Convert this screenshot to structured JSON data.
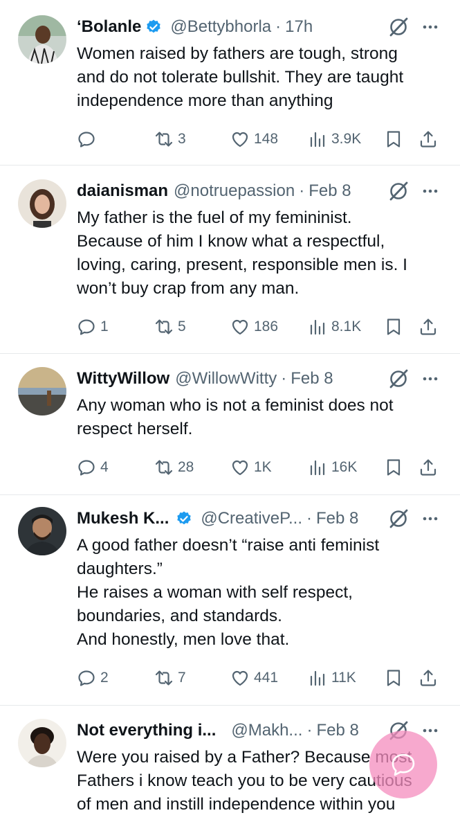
{
  "tweets": [
    {
      "name": "‘Bolanle",
      "verified": true,
      "handle": "@Bettybhorla",
      "time": "17h",
      "lines": [
        "Women raised by fathers are tough, strong",
        "and do not tolerate bullshit. They are taught",
        "independence more than anything"
      ],
      "replies": "",
      "reposts": "3",
      "likes": "148",
      "views": "3.9K"
    },
    {
      "name": "daianisman",
      "verified": false,
      "handle": "@notruepassion",
      "time": "Feb 8",
      "lines": [
        "My father is the fuel of my femininist.",
        "Because of him I know what a respectful,",
        "loving, caring, present, responsible men is. I",
        "won’t buy crap from any man."
      ],
      "replies": "1",
      "reposts": "5",
      "likes": "186",
      "views": "8.1K"
    },
    {
      "name": "WittyWillow",
      "verified": false,
      "handle": "@WillowWitty",
      "time": "Feb 8",
      "lines": [
        "Any woman who is not a feminist does not",
        "respect herself."
      ],
      "replies": "4",
      "reposts": "28",
      "likes": "1K",
      "views": "16K"
    },
    {
      "name": "Mukesh K...",
      "verified": true,
      "handle": "@CreativeP...",
      "time": "Feb 8",
      "lines": [
        "A good father doesn’t “raise anti feminist",
        "daughters.”",
        "He raises a woman with self respect,",
        "boundaries, and standards.",
        "And honestly, men love that."
      ],
      "replies": "2",
      "reposts": "7",
      "likes": "441",
      "views": "11K"
    },
    {
      "name": "Not everything i...",
      "verified": false,
      "handle": "@Makh...",
      "time": "Feb 8",
      "lines": [
        "Were you raised by a Father? Because most",
        "Fathers i know teach you to be very cautious",
        "of men and instill independence within you"
      ],
      "replies": "",
      "reposts": "",
      "likes": "",
      "views": ""
    }
  ],
  "icons": {
    "reply": "reply-icon",
    "repost": "repost-icon",
    "like": "like-icon",
    "views": "views-icon",
    "bookmark": "bookmark-icon",
    "share": "share-icon",
    "grok": "grok-icon",
    "more": "more-icon",
    "verified": "verified-badge-icon",
    "compose": "compose-fab-icon"
  },
  "colors": {
    "text": "#0f1419",
    "muted": "#536471",
    "verified": "#1d9bf0",
    "separator": "#e6e9eb",
    "fab": "#f48cbe"
  }
}
